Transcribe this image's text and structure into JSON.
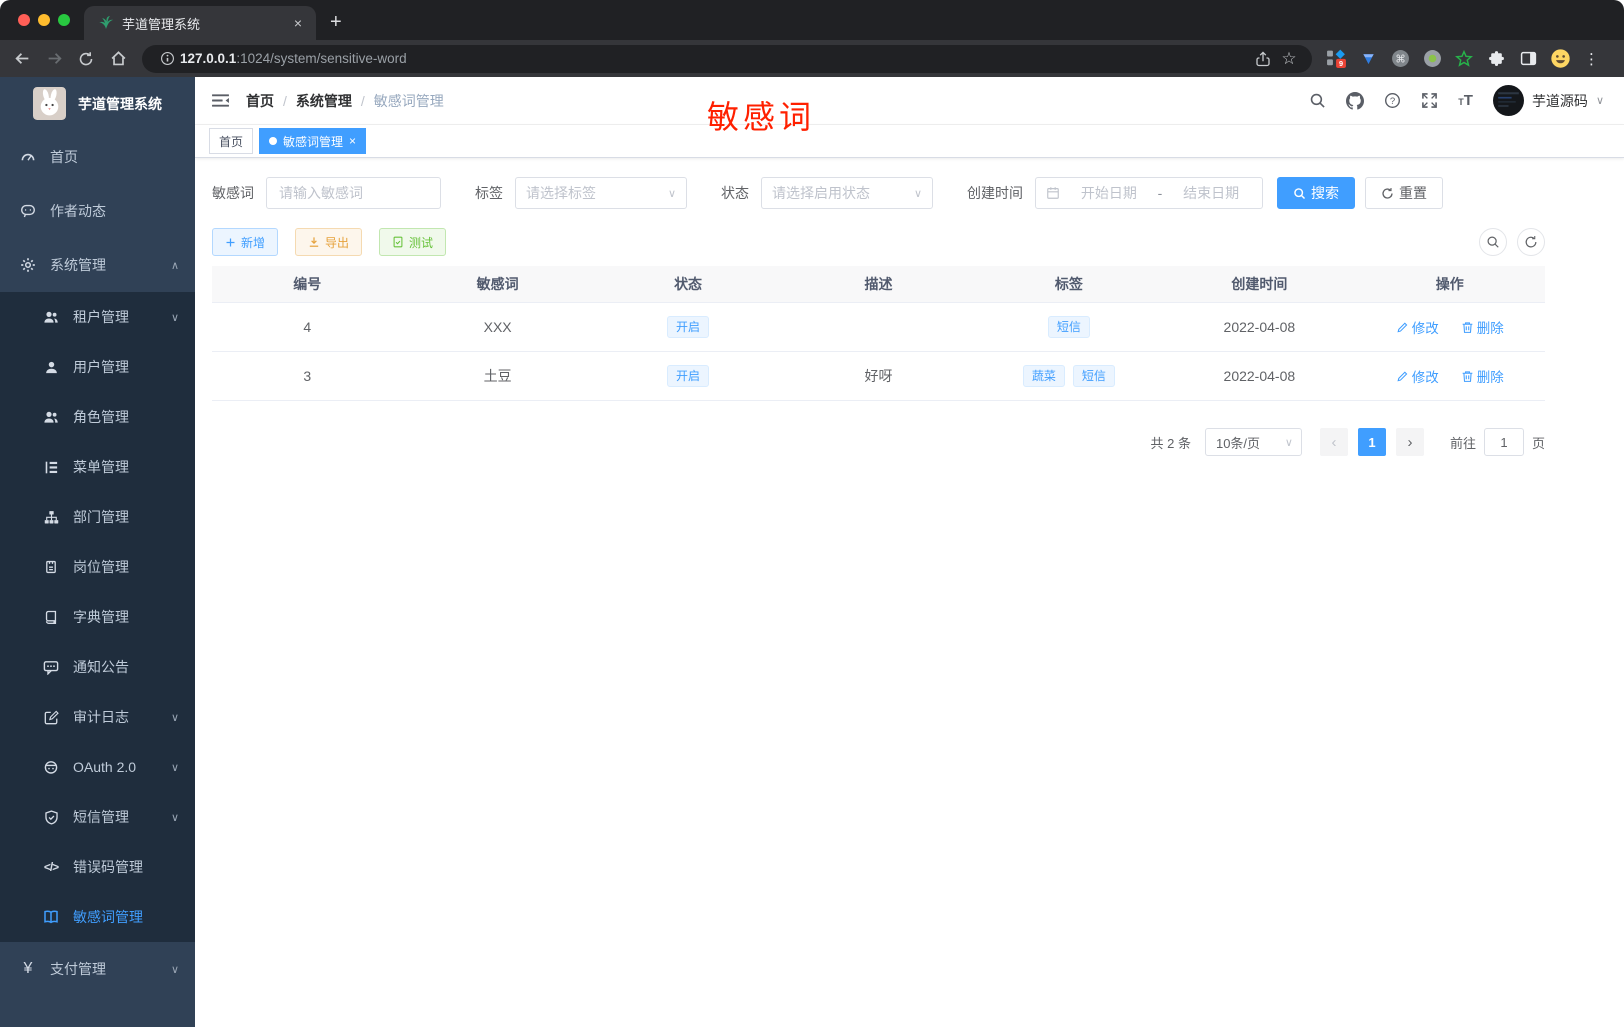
{
  "colors": {
    "accent": "#409eff",
    "warning": "#e6a23c",
    "success": "#67c23a",
    "annotation_red": "#ff2000",
    "sidebar_bg": "#304156",
    "submenu_bg": "#1f2d3d",
    "tag_bg": "#ecf5ff"
  },
  "browser": {
    "tab_title": "芋道管理系统",
    "url_host": "127.0.0.1",
    "url_rest": ":1024/system/sensitive-word",
    "extension_badge": "9"
  },
  "sidebar": {
    "logo_title": "芋道管理系统",
    "items": [
      {
        "label": "首页"
      },
      {
        "label": "作者动态"
      },
      {
        "label": "系统管理"
      },
      {
        "label": "租户管理"
      },
      {
        "label": "用户管理"
      },
      {
        "label": "角色管理"
      },
      {
        "label": "菜单管理"
      },
      {
        "label": "部门管理"
      },
      {
        "label": "岗位管理"
      },
      {
        "label": "字典管理"
      },
      {
        "label": "通知公告"
      },
      {
        "label": "审计日志"
      },
      {
        "label": "OAuth 2.0"
      },
      {
        "label": "短信管理"
      },
      {
        "label": "错误码管理"
      },
      {
        "label": "敏感词管理"
      },
      {
        "label": "支付管理"
      }
    ]
  },
  "navbar": {
    "breadcrumb": [
      "首页",
      "系统管理",
      "敏感词管理"
    ],
    "username": "芋道源码",
    "annotation": "敏感词"
  },
  "tags_view": {
    "tabs": [
      "首页",
      "敏感词管理"
    ]
  },
  "filters": {
    "keyword_label": "敏感词",
    "keyword_placeholder": "请输入敏感词",
    "tag_label": "标签",
    "tag_placeholder": "请选择标签",
    "status_label": "状态",
    "status_placeholder": "请选择启用状态",
    "create_time_label": "创建时间",
    "start_placeholder": "开始日期",
    "range_separator": "-",
    "end_placeholder": "结束日期",
    "search_label": "搜索",
    "reset_label": "重置"
  },
  "toolbar": {
    "add_label": "新增",
    "export_label": "导出",
    "test_label": "测试"
  },
  "table": {
    "columns": [
      "编号",
      "敏感词",
      "状态",
      "描述",
      "标签",
      "创建时间",
      "操作"
    ],
    "rows": [
      {
        "id": "4",
        "word": "XXX",
        "status": "开启",
        "description": "",
        "tags": [
          "短信"
        ],
        "create_time": "2022-04-08"
      },
      {
        "id": "3",
        "word": "土豆",
        "status": "开启",
        "description": "好呀",
        "tags": [
          "蔬菜",
          "短信"
        ],
        "create_time": "2022-04-08"
      }
    ],
    "edit_label": "修改",
    "delete_label": "删除"
  },
  "pagination": {
    "total_text": "共 2 条",
    "page_size": "10条/页",
    "current_page": "1",
    "goto_label": "前往",
    "goto_value": "1",
    "page_unit": "页"
  },
  "glyphs": {
    "breadcrumb_sep": "/",
    "caret_down": "∨",
    "caret_up": "∧",
    "close": "×",
    "kebab": "⋮",
    "prev": "‹",
    "next": "›",
    "star": "☆",
    "cmd": "⌘",
    "code_tag": "</>",
    "yen": "¥"
  }
}
